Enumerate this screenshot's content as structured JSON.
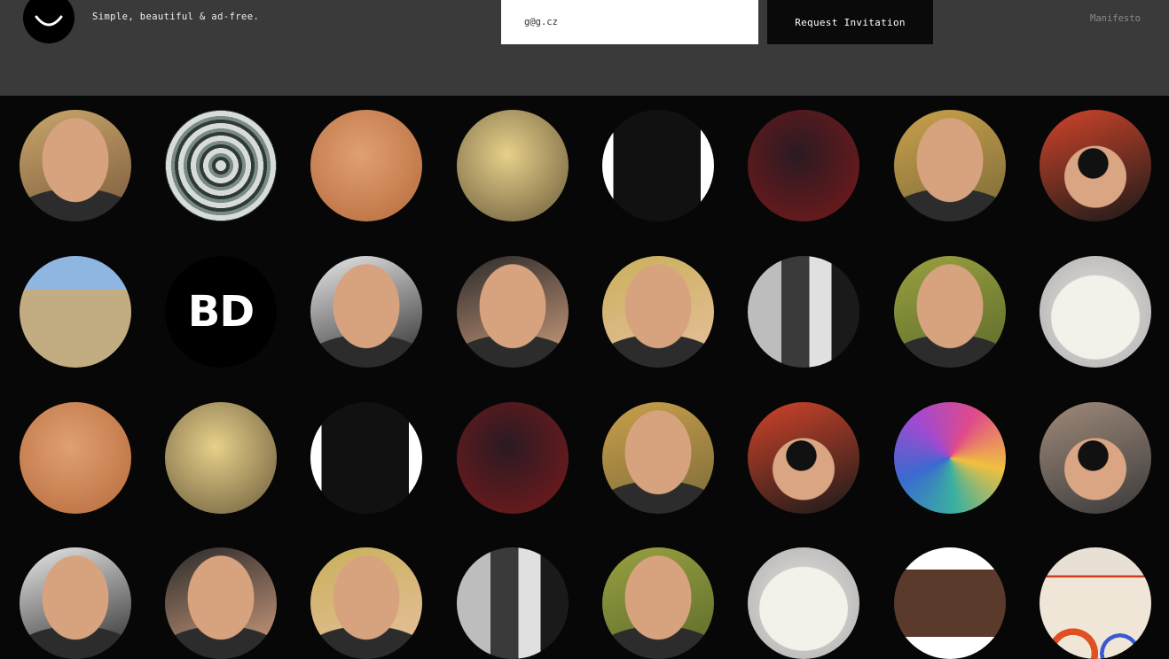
{
  "header": {
    "tagline": "Simple, beautiful & ad-free.",
    "email_value": "g@g.cz",
    "request_button": "Request Invitation",
    "manifesto_link": "Manifesto",
    "background": "#3a3a3a"
  },
  "avatars": [
    {
      "id": "user-sunglasses-woman",
      "bg": [
        "#c9a66b",
        "#7a5a3c"
      ],
      "kind": "face"
    },
    {
      "id": "concentric-rings",
      "bg": [
        "#d8dcd8",
        "#2e3a36"
      ],
      "kind": "rings"
    },
    {
      "id": "plaza-building",
      "bg": [
        "#e0a070",
        "#b66a3c"
      ],
      "kind": "scene"
    },
    {
      "id": "pastry",
      "bg": [
        "#e6d08a",
        "#6b5b3b"
      ],
      "kind": "food"
    },
    {
      "id": "dark-figure",
      "bg": [
        "#ffffff",
        "#111111"
      ],
      "kind": "split"
    },
    {
      "id": "woman-in-chair",
      "bg": [
        "#2a1a22",
        "#7a1a1a"
      ],
      "kind": "dark"
    },
    {
      "id": "man-red-cap",
      "bg": [
        "#c9a04a",
        "#7a6a3a"
      ],
      "kind": "face"
    },
    {
      "id": "camera-man",
      "bg": [
        "#d0442a",
        "#1a1a1a"
      ],
      "kind": "camera"
    },
    {
      "id": "hiker-trail",
      "bg": [
        "#8fb6e0",
        "#b09a6a"
      ],
      "kind": "landscape"
    },
    {
      "id": "bd-logo",
      "bg": [
        "#000000",
        "#000000"
      ],
      "kind": "text",
      "text": "BD"
    },
    {
      "id": "man-glasses",
      "bg": [
        "#e8e8e8",
        "#2a2a2a"
      ],
      "kind": "face"
    },
    {
      "id": "man-portrait",
      "bg": [
        "#2a2a2a",
        "#d4a080"
      ],
      "kind": "face"
    },
    {
      "id": "skull-facepaint",
      "bg": [
        "#c9b05a",
        "#e8c0a0"
      ],
      "kind": "face"
    },
    {
      "id": "bw-portrait",
      "bg": [
        "#bdbdbd",
        "#1a1a1a"
      ],
      "kind": "bw"
    },
    {
      "id": "man-greenery",
      "bg": [
        "#9aa040",
        "#5a6a2a"
      ],
      "kind": "face"
    },
    {
      "id": "white-cat",
      "bg": [
        "#e8e4e0",
        "#b0b0b0"
      ],
      "kind": "cat"
    },
    {
      "id": "plaza-building-2",
      "bg": [
        "#e0a070",
        "#b66a3c"
      ],
      "kind": "scene"
    },
    {
      "id": "pastry-2",
      "bg": [
        "#e6d08a",
        "#6b5b3b"
      ],
      "kind": "food"
    },
    {
      "id": "dark-figure-2",
      "bg": [
        "#ffffff",
        "#111111"
      ],
      "kind": "split"
    },
    {
      "id": "woman-in-chair-2",
      "bg": [
        "#2a1a22",
        "#7a1a1a"
      ],
      "kind": "dark"
    },
    {
      "id": "man-red-cap-2",
      "bg": [
        "#c9a04a",
        "#7a6a3a"
      ],
      "kind": "face"
    },
    {
      "id": "camera-man-2",
      "bg": [
        "#d0442a",
        "#1a1a1a"
      ],
      "kind": "camera"
    },
    {
      "id": "colorful-art",
      "bg": [
        "#d04a8a",
        "#3a8ac0"
      ],
      "kind": "art"
    },
    {
      "id": "photographer",
      "bg": [
        "#a08a7a",
        "#3a3a3a"
      ],
      "kind": "camera"
    },
    {
      "id": "man-glasses-2",
      "bg": [
        "#e8e8e8",
        "#2a2a2a"
      ],
      "kind": "face"
    },
    {
      "id": "man-portrait-2",
      "bg": [
        "#2a2a2a",
        "#d4a080"
      ],
      "kind": "face"
    },
    {
      "id": "skull-facepaint-2",
      "bg": [
        "#c9b05a",
        "#e8c0a0"
      ],
      "kind": "face"
    },
    {
      "id": "bw-portrait-2",
      "bg": [
        "#bdbdbd",
        "#1a1a1a"
      ],
      "kind": "bw"
    },
    {
      "id": "man-greenery-2",
      "bg": [
        "#9aa040",
        "#5a6a2a"
      ],
      "kind": "face"
    },
    {
      "id": "white-cat-2",
      "bg": [
        "#e8e4e0",
        "#b0b0b0"
      ],
      "kind": "cat"
    },
    {
      "id": "framed-photo",
      "bg": [
        "#ffffff",
        "#5a3a2a"
      ],
      "kind": "frame"
    },
    {
      "id": "orange-arcs",
      "bg": [
        "#f0e6d8",
        "#e05020"
      ],
      "kind": "arcs"
    }
  ]
}
